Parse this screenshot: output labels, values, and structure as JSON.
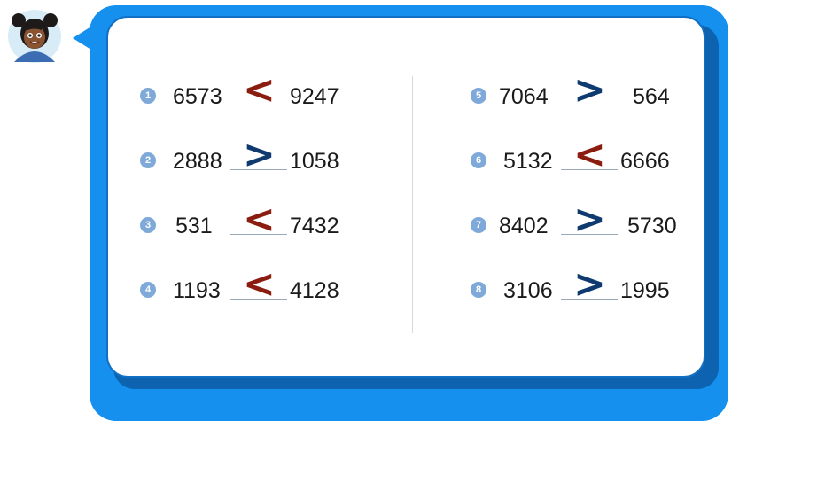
{
  "colors": {
    "frame": "#1590ee",
    "card_shadow": "#0d63b0",
    "badge": "#7fa9d8",
    "less_than_sign": "#8a1d10",
    "greater_than_sign": "#0e3a6f"
  },
  "avatar": {
    "icon": "girl-character-avatar-icon"
  },
  "left_column": [
    {
      "badge": "1",
      "a": "6573",
      "sign": "<",
      "b": "9247"
    },
    {
      "badge": "2",
      "a": "2888",
      "sign": ">",
      "b": "1058"
    },
    {
      "badge": "3",
      "a": "531",
      "sign": "<",
      "b": "7432"
    },
    {
      "badge": "4",
      "a": "1193",
      "sign": "<",
      "b": "4128"
    }
  ],
  "right_column": [
    {
      "badge": "5",
      "a": "7064",
      "sign": ">",
      "b": "564"
    },
    {
      "badge": "6",
      "a": "5132",
      "sign": "<",
      "b": "6666"
    },
    {
      "badge": "7",
      "a": "8402",
      "sign": ">",
      "b": "5730"
    },
    {
      "badge": "8",
      "a": "3106",
      "sign": ">",
      "b": "1995"
    }
  ]
}
